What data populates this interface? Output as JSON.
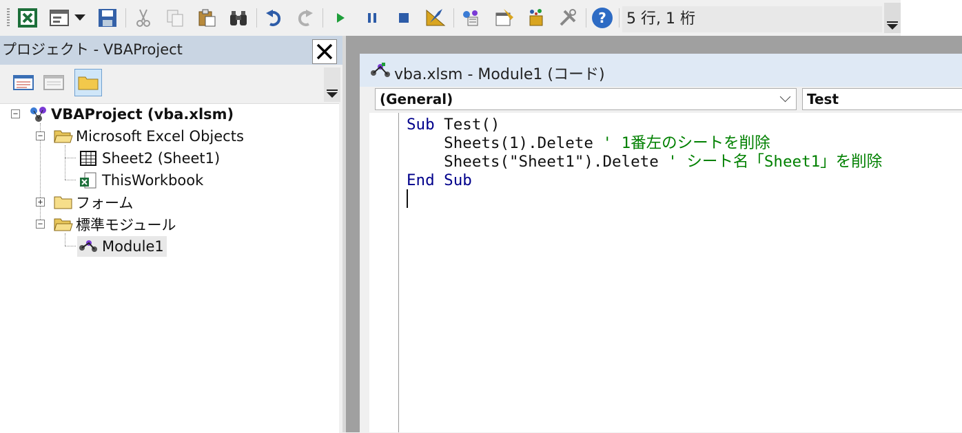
{
  "toolbar": {
    "buttons": [
      {
        "name": "view-excel-icon"
      },
      {
        "name": "insert-userform-icon"
      },
      {
        "name": "save-icon"
      },
      {
        "name": "cut-icon"
      },
      {
        "name": "copy-icon"
      },
      {
        "name": "paste-icon"
      },
      {
        "name": "find-icon"
      },
      {
        "name": "undo-icon"
      },
      {
        "name": "redo-icon"
      },
      {
        "name": "run-icon"
      },
      {
        "name": "break-icon"
      },
      {
        "name": "reset-icon"
      },
      {
        "name": "design-mode-icon"
      },
      {
        "name": "project-explorer-icon"
      },
      {
        "name": "properties-window-icon"
      },
      {
        "name": "object-browser-icon"
      },
      {
        "name": "toolbox-icon"
      },
      {
        "name": "help-icon"
      }
    ],
    "status": "5 行, 1 桁"
  },
  "project_panel": {
    "title": "プロジェクト - VBAProject",
    "tree": {
      "root": "VBAProject (vba.xlsm)",
      "excel_objects": "Microsoft Excel Objects",
      "sheet2": "Sheet2 (Sheet1)",
      "thisworkbook": "ThisWorkbook",
      "forms": "フォーム",
      "modules": "標準モジュール",
      "module1": "Module1"
    }
  },
  "code_window": {
    "title": "vba.xlsm - Module1 (コード)",
    "object_combo": "(General)",
    "procedure_combo": "Test",
    "lines": [
      [
        {
          "t": "Sub",
          "c": "kw"
        },
        {
          "t": " Test()",
          "c": ""
        }
      ],
      [
        {
          "t": "    Sheets(1).Delete ",
          "c": ""
        },
        {
          "t": "' 1番左のシートを削除",
          "c": "cm"
        }
      ],
      [
        {
          "t": "    Sheets(\"Sheet1\").Delete ",
          "c": ""
        },
        {
          "t": "' シート名「Sheet1」を削除",
          "c": "cm"
        }
      ],
      [
        {
          "t": "End Sub",
          "c": "kw"
        }
      ],
      [
        {
          "t": "",
          "c": ""
        }
      ]
    ]
  },
  "colors": {
    "keyword": "#00008b",
    "comment": "#008000",
    "title_bar": "#dfe9f5"
  }
}
